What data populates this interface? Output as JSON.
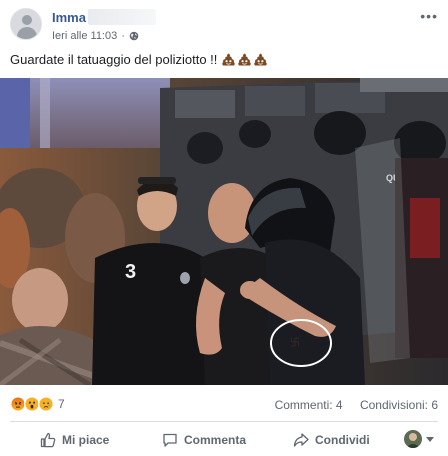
{
  "post": {
    "author": "Imma I",
    "timestamp": "Ieri alle 11:03",
    "privacy_icon": "globe-icon",
    "message": "Guardate il tatuaggio del poliziotto !!",
    "emoji_icon": "pile-of-poo-icon"
  },
  "photo": {
    "jersey_number": "3",
    "van_text": "QUIS"
  },
  "engagement": {
    "reaction_icons": [
      "angry-icon",
      "wow-icon",
      "sad-icon"
    ],
    "reaction_count": "7",
    "comments": "Commenti: 4",
    "shares": "Condivisioni: 6"
  },
  "actions": {
    "like": "Mi piace",
    "comment": "Commenta",
    "share": "Condividi"
  },
  "colors": {
    "link": "#385898",
    "secondary": "#606770",
    "angry": "#e9710f",
    "wow": "#f7b125"
  }
}
